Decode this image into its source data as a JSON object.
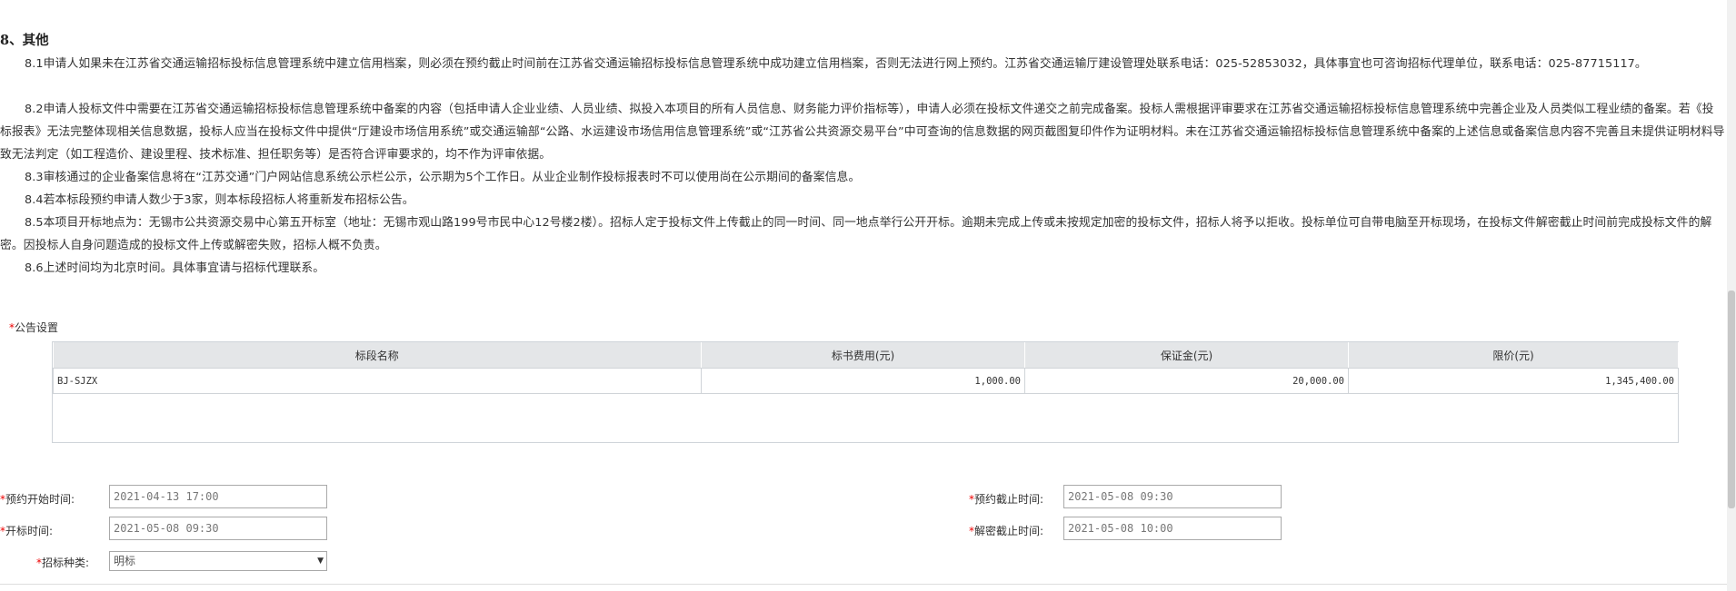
{
  "section": {
    "title": "8、其他",
    "paragraphs": [
      "8.1申请人如果未在江苏省交通运输招标投标信息管理系统中建立信用档案，则必须在预约截止时间前在江苏省交通运输招标投标信息管理系统中成功建立信用档案，否则无法进行网上预约。江苏省交通运输厅建设管理处联系电话：025-52853032，具体事宜也可咨询招标代理单位，联系电话：025-87715117。",
      "8.2申请人投标文件中需要在江苏省交通运输招标投标信息管理系统中备案的内容（包括申请人企业业绩、人员业绩、拟投入本项目的所有人员信息、财务能力评价指标等），申请人必须在投标文件递交之前完成备案。投标人需根据评审要求在江苏省交通运输招标投标信息管理系统中完善企业及人员类似工程业绩的备案。若《投标报表》无法完整体现相关信息数据，投标人应当在投标文件中提供“厅建设市场信用系统”或交通运输部“公路、水运建设市场信用信息管理系统”或“江苏省公共资源交易平台”中可查询的信息数据的网页截图复印件作为证明材料。未在江苏省交通运输招标投标信息管理系统中备案的上述信息或备案信息内容不完善且未提供证明材料导致无法判定（如工程造价、建设里程、技术标准、担任职务等）是否符合评审要求的，均不作为评审依据。",
      "8.3审核通过的企业备案信息将在“江苏交通”门户网站信息系统公示栏公示，公示期为5个工作日。从业企业制作投标报表时不可以使用尚在公示期间的备案信息。",
      "8.4若本标段预约申请人数少于3家，则本标段招标人将重新发布招标公告。",
      "8.5本项目开标地点为：无锡市公共资源交易中心第五开标室（地址：无锡市观山路199号市民中心12号楼2楼）。招标人定于投标文件上传截止的同一时间、同一地点举行公开开标。逾期未完成上传或未按规定加密的投标文件，招标人将予以拒收。投标单位可自带电脑至开标现场，在投标文件解密截止时间前完成投标文件的解密。因投标人自身问题造成的投标文件上传或解密失败，招标人概不负责。",
      "8.6上述时间均为北京时间。具体事宜请与招标代理联系。"
    ]
  },
  "announcement": {
    "required_mark": "*",
    "label": "公告设置",
    "columns": [
      "标段名称",
      "标书费用(元)",
      "保证金(元)",
      "限价(元)"
    ],
    "rows": [
      [
        "BJ-SJZX",
        "1,000.00",
        "20,000.00",
        "1,345,400.00"
      ]
    ]
  },
  "form": {
    "required_mark": "*",
    "reserve_start": {
      "label": "预约开始时间:",
      "value": "2021-04-13 17:00"
    },
    "reserve_end": {
      "label": "预约截止时间:",
      "value": "2021-05-08 09:30"
    },
    "open_time": {
      "label": "开标时间:",
      "value": "2021-05-08 09:30"
    },
    "decrypt_end": {
      "label": "解密截止时间:",
      "value": "2021-05-08 10:00"
    },
    "bid_type": {
      "label": "招标种类:",
      "value": "明标"
    }
  }
}
